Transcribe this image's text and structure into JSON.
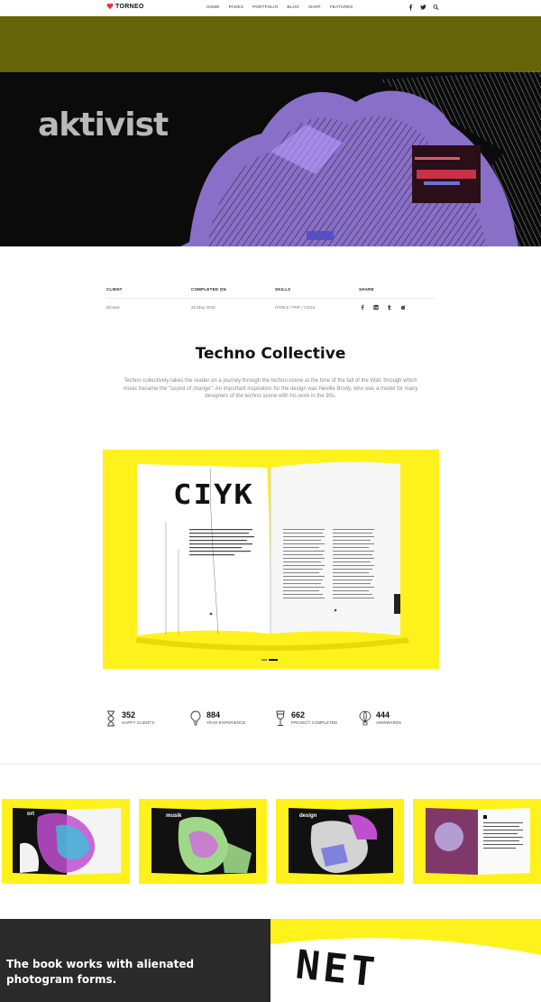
{
  "header": {
    "logo": "TORNEO",
    "nav": [
      "HOME",
      "PAGES",
      "PORTFOLIO",
      "BLOG",
      "SHOP",
      "FEATURES"
    ],
    "icons": [
      "facebook-icon",
      "twitter-icon",
      "search-icon"
    ]
  },
  "hero": {
    "word": "aktivist",
    "colors": {
      "band": "#646409",
      "background": "#0b0b0b",
      "purple": "#8a6fc9"
    }
  },
  "project_info": {
    "client_label": "CLIENT",
    "client_value": "Elmatic",
    "completed_label": "COMPLETED ON",
    "completed_value": "22 May 2018",
    "skills_label": "SKILLS",
    "skills_value": "HTML5 / PHP / CSS3",
    "share_label": "SHARE",
    "share_icons": [
      "facebook-icon",
      "linkedin-icon",
      "tumblr-icon",
      "reddit-icon"
    ]
  },
  "content": {
    "title": "Techno Collective",
    "description": "Techno collectively takes the reader on a journey through the techno scene at the time of the fall of the Wall, through which music became the \"sound of change\". An important inspiration for the design was Neville Brody, who was a model for many designers of the techno scene with his work in the 90s.",
    "magazine_heading": "CIYK"
  },
  "stats": [
    {
      "icon": "hourglass-icon",
      "number": "352",
      "label": "HAPPY CLIENTS"
    },
    {
      "icon": "lightbulb-icon",
      "number": "884",
      "label": "YEAR EXPERIENCE"
    },
    {
      "icon": "wine-glass-icon",
      "number": "662",
      "label": "PROJECT COMPLETED"
    },
    {
      "icon": "balloon-icon",
      "number": "444",
      "label": "AWWWARDS"
    }
  ],
  "gallery": [
    {
      "word": "ort"
    },
    {
      "word": "musik"
    },
    {
      "word": "design"
    },
    {
      "word": ""
    }
  ],
  "bottom": {
    "text": "The book works with alienated photogram forms.",
    "big_letters": "NET"
  },
  "accent_yellow": "#fff11c"
}
